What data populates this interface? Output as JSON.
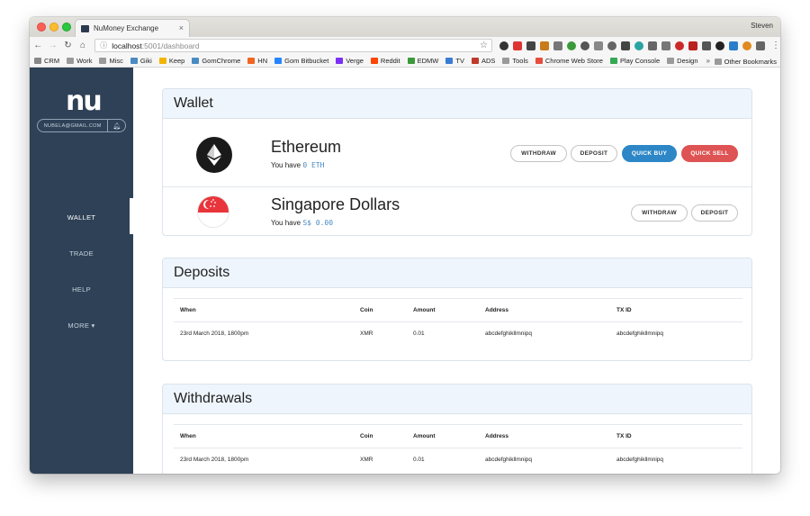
{
  "browser": {
    "tab_title": "NuMoney Exchange",
    "tab_close": "×",
    "profile": "Steven",
    "url_host": "localhost",
    "url_path": ":5001/dashboard",
    "bookmarks": [
      {
        "label": "CRM"
      },
      {
        "label": "Work"
      },
      {
        "label": "Misc"
      },
      {
        "label": "Giki"
      },
      {
        "label": "Keep"
      },
      {
        "label": "GomChrome"
      },
      {
        "label": "HN"
      },
      {
        "label": "Gom Bitbucket"
      },
      {
        "label": "Verge"
      },
      {
        "label": "Reddit"
      },
      {
        "label": "EDMW"
      },
      {
        "label": "TV"
      },
      {
        "label": "ADS"
      },
      {
        "label": "Tools"
      },
      {
        "label": "Chrome Web Store"
      },
      {
        "label": "Play Console"
      },
      {
        "label": "Design"
      }
    ],
    "bookmarks_overflow": "»",
    "other_bookmarks": "Other Bookmarks"
  },
  "sidebar": {
    "logo": "nu",
    "email": "NUBELA@GMAIL.COM",
    "nav": [
      {
        "label": "WALLET",
        "active": true
      },
      {
        "label": "TRADE"
      },
      {
        "label": "HELP"
      },
      {
        "label": "MORE ▾"
      }
    ]
  },
  "wallet": {
    "title": "Wallet",
    "assets": [
      {
        "name": "Ethereum",
        "balance_prefix": "You have",
        "balance_value": "0 ETH",
        "buttons": [
          "WITHDRAW",
          "DEPOSIT",
          "QUICK BUY",
          "QUICK SELL"
        ]
      },
      {
        "name": "Singapore Dollars",
        "balance_prefix": "You have",
        "balance_value": "S$ 0.00",
        "buttons": [
          "WITHDRAW",
          "DEPOSIT"
        ]
      }
    ]
  },
  "deposits": {
    "title": "Deposits",
    "columns": [
      "When",
      "Coin",
      "Amount",
      "Address",
      "TX ID"
    ],
    "rows": [
      [
        "23rd March 2018, 1800pm",
        "XMR",
        "0.01",
        "abcdefghikllmnipq",
        "abcdefghikllmnipq"
      ]
    ]
  },
  "withdrawals": {
    "title": "Withdrawals",
    "columns": [
      "When",
      "Coin",
      "Amount",
      "Address",
      "TX ID"
    ],
    "rows": [
      [
        "23rd March 2018, 1800pm",
        "XMR",
        "0.01",
        "abcdefghikllmnipq",
        "abcdefghikllmnipq"
      ]
    ]
  },
  "colors": {
    "sidebar_bg": "#2e4156",
    "card_header_bg": "#eef5fc",
    "quick_buy": "#2d87c6",
    "quick_sell": "#de5353",
    "balance_text": "#4a8bc2"
  }
}
